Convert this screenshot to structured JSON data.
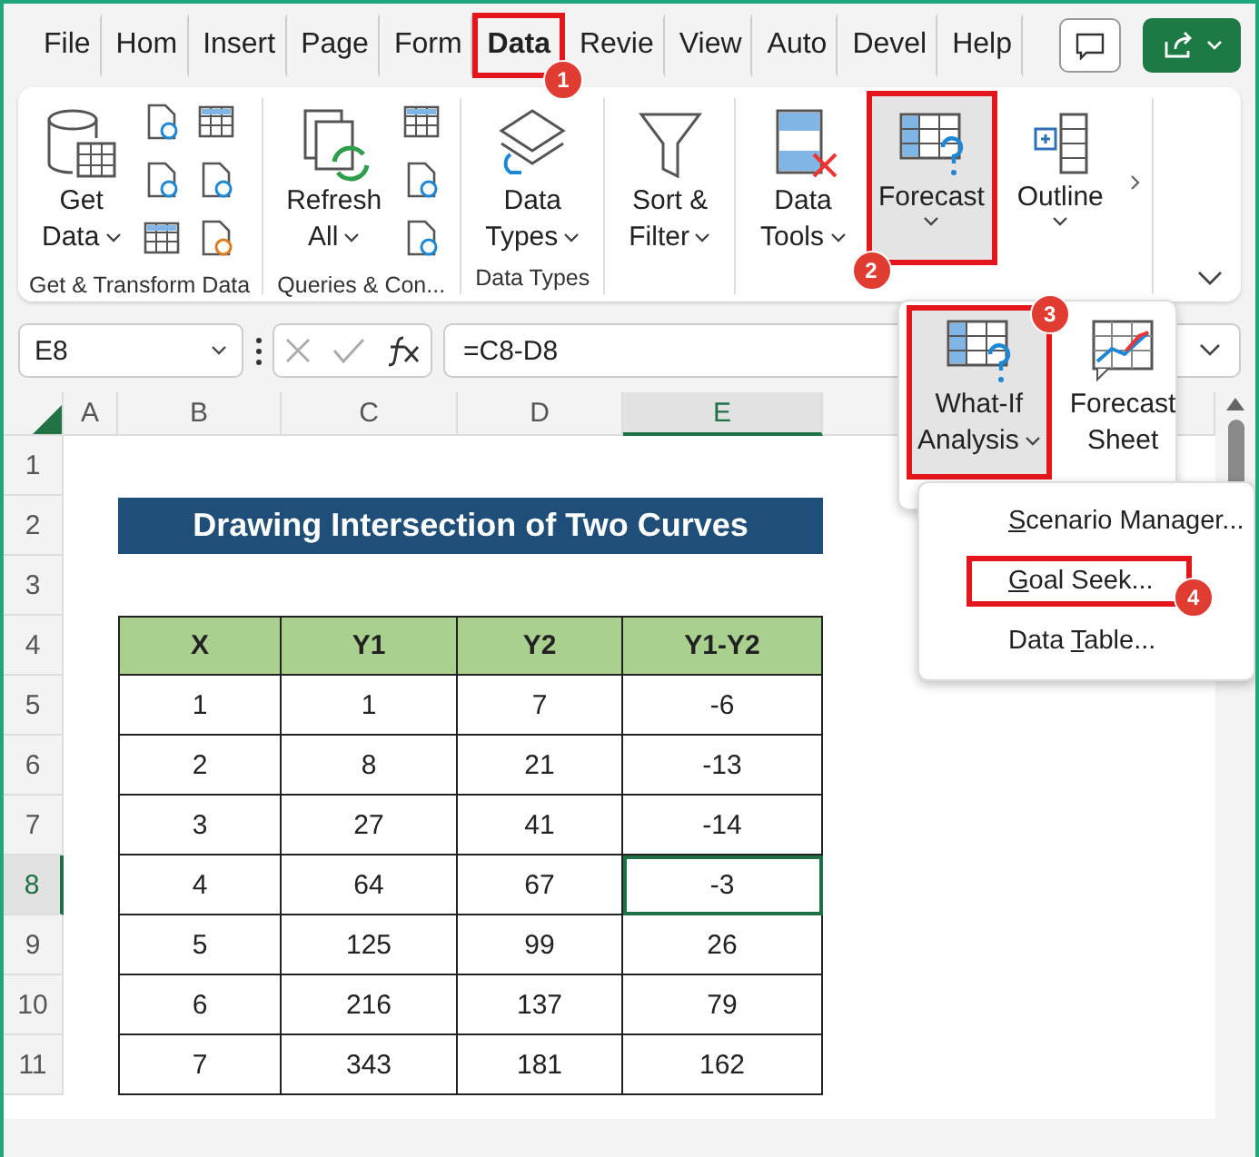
{
  "tabs": [
    {
      "label": "File",
      "selected": false
    },
    {
      "label": "Hom",
      "selected": false
    },
    {
      "label": "Insert",
      "selected": false
    },
    {
      "label": "Page",
      "selected": false
    },
    {
      "label": "Form",
      "selected": false
    },
    {
      "label": "Data",
      "selected": true,
      "badge": "1"
    },
    {
      "label": "Revie",
      "selected": false
    },
    {
      "label": "View",
      "selected": false
    },
    {
      "label": "Auto",
      "selected": false
    },
    {
      "label": "Devel",
      "selected": false
    },
    {
      "label": "Help",
      "selected": false
    }
  ],
  "ribbon": {
    "groups": [
      {
        "label": "Get & Transform Data",
        "buttons": [
          {
            "kind": "get-data",
            "lines": [
              "Get",
              "Data"
            ],
            "dropdown": true
          }
        ],
        "kind": "get-transform"
      },
      {
        "label": "Queries & Con...",
        "buttons": [
          {
            "kind": "refresh",
            "lines": [
              "Refresh",
              "All"
            ],
            "dropdown": true
          }
        ],
        "kind": "queries"
      },
      {
        "label": "Data Types",
        "buttons": [
          {
            "kind": "data-types",
            "lines": [
              "Data",
              "Types"
            ],
            "dropdown": true
          }
        ]
      },
      {
        "buttons": [
          {
            "kind": "sort-filter",
            "lines": [
              "Sort &",
              "Filter"
            ],
            "dropdown": true
          }
        ]
      },
      {
        "buttons": [
          {
            "kind": "data-tools",
            "lines": [
              "Data",
              "Tools"
            ],
            "dropdown": true
          },
          {
            "kind": "forecast",
            "lines": [
              "Forecast"
            ],
            "dropdown": true,
            "expanded": true,
            "badge": "2"
          },
          {
            "kind": "outline",
            "lines": [
              "Outline"
            ],
            "dropdown": true
          }
        ]
      }
    ]
  },
  "forecast_panel": {
    "buttons": [
      {
        "kind": "what-if",
        "lines": [
          "What-If",
          "Analysis"
        ],
        "dropdown": true,
        "selected": true,
        "badge": "3"
      },
      {
        "kind": "forecast-sheet",
        "lines": [
          "Forecast",
          "Sheet"
        ],
        "dropdown": false,
        "selected": false
      }
    ]
  },
  "menu": {
    "items": [
      {
        "accesskey": "S",
        "rest": "cenario Manager...",
        "selected": false
      },
      {
        "accesskey": "G",
        "rest": "oal Seek...",
        "selected": true,
        "badge": "4"
      },
      {
        "before": "Data ",
        "accesskey": "T",
        "rest": "able...",
        "selected": false
      }
    ]
  },
  "formula_bar": {
    "name_box": "E8",
    "formula": "=C8-D8"
  },
  "sheet": {
    "columns": [
      {
        "label": "A",
        "selected": false
      },
      {
        "label": "B",
        "selected": false
      },
      {
        "label": "C",
        "selected": false
      },
      {
        "label": "D",
        "selected": false
      },
      {
        "label": "E",
        "selected": true
      }
    ],
    "rows": [
      {
        "label": "1",
        "selected": false,
        "kind": "blank"
      },
      {
        "label": "2",
        "selected": false,
        "kind": "title",
        "text": "Drawing Intersection of Two Curves"
      },
      {
        "label": "3",
        "selected": false,
        "kind": "blank"
      },
      {
        "label": "4",
        "selected": false,
        "kind": "header",
        "cells": [
          {
            "text": "X",
            "selected": false
          },
          {
            "text": "Y1",
            "selected": false
          },
          {
            "text": "Y2",
            "selected": false
          },
          {
            "text": "Y1-Y2",
            "selected": false
          }
        ]
      },
      {
        "label": "5",
        "selected": false,
        "kind": "data",
        "cells": [
          {
            "text": "1",
            "selected": false
          },
          {
            "text": "1",
            "selected": false
          },
          {
            "text": "7",
            "selected": false
          },
          {
            "text": "-6",
            "selected": false
          }
        ]
      },
      {
        "label": "6",
        "selected": false,
        "kind": "data",
        "cells": [
          {
            "text": "2",
            "selected": false
          },
          {
            "text": "8",
            "selected": false
          },
          {
            "text": "21",
            "selected": false
          },
          {
            "text": "-13",
            "selected": false
          }
        ]
      },
      {
        "label": "7",
        "selected": false,
        "kind": "data",
        "cells": [
          {
            "text": "3",
            "selected": false
          },
          {
            "text": "27",
            "selected": false
          },
          {
            "text": "41",
            "selected": false
          },
          {
            "text": "-14",
            "selected": false
          }
        ]
      },
      {
        "label": "8",
        "selected": true,
        "kind": "data",
        "cells": [
          {
            "text": "4",
            "selected": false
          },
          {
            "text": "64",
            "selected": false
          },
          {
            "text": "67",
            "selected": false
          },
          {
            "text": "-3",
            "selected": true
          }
        ]
      },
      {
        "label": "9",
        "selected": false,
        "kind": "data",
        "cells": [
          {
            "text": "5",
            "selected": false
          },
          {
            "text": "125",
            "selected": false
          },
          {
            "text": "99",
            "selected": false
          },
          {
            "text": "26",
            "selected": false
          }
        ]
      },
      {
        "label": "10",
        "selected": false,
        "kind": "data",
        "cells": [
          {
            "text": "6",
            "selected": false
          },
          {
            "text": "216",
            "selected": false
          },
          {
            "text": "137",
            "selected": false
          },
          {
            "text": "79",
            "selected": false
          }
        ]
      },
      {
        "label": "11",
        "selected": false,
        "kind": "data",
        "cells": [
          {
            "text": "7",
            "selected": false
          },
          {
            "text": "343",
            "selected": false
          },
          {
            "text": "181",
            "selected": false
          },
          {
            "text": "162",
            "selected": false
          }
        ]
      }
    ]
  }
}
